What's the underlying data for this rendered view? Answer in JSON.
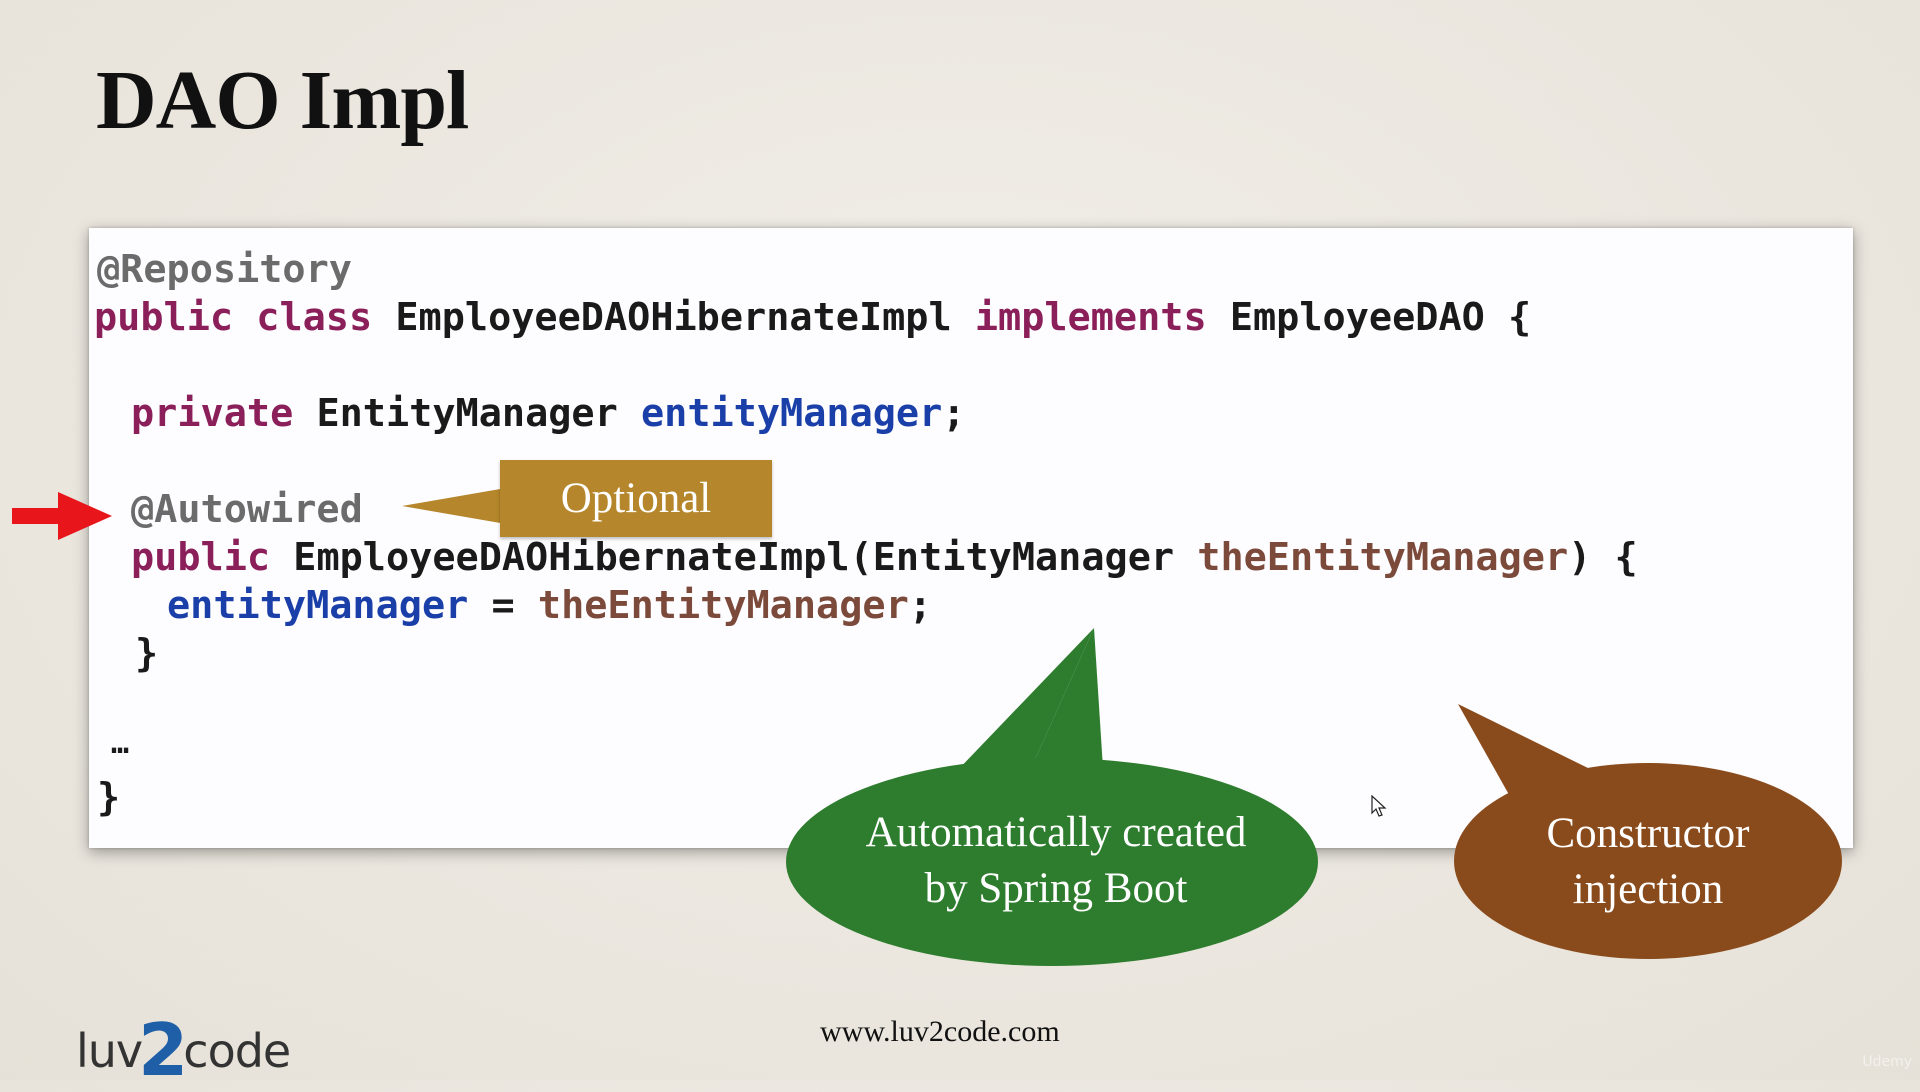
{
  "slide": {
    "title": "DAO Impl"
  },
  "code": {
    "line1": {
      "annotation": "@Repository"
    },
    "line2": {
      "kw1": "public",
      "kw2": "class",
      "name": "EmployeeDAOHibernateImpl",
      "kw3": "implements",
      "iface": "EmployeeDAO",
      "brace": "{"
    },
    "line3": {
      "kw": "private",
      "type": "EntityManager",
      "field": "entityManager",
      "semi": ";"
    },
    "line4": {
      "annotation": "@Autowired"
    },
    "line5": {
      "kw": "public",
      "name": "EmployeeDAOHibernateImpl(EntityManager",
      "param": "theEntityManager",
      "rest": ") {"
    },
    "line6": {
      "field": "entityManager",
      "op": "=",
      "param": "theEntityManager",
      "semi": ";"
    },
    "line7": {
      "brace": "}"
    },
    "line8": {
      "ellipsis": "…"
    },
    "line9": {
      "brace": "}"
    }
  },
  "callouts": {
    "optional": "Optional",
    "auto_line1": "Automatically created",
    "auto_line2": "by Spring Boot",
    "ctor_line1": "Constructor",
    "ctor_line2": "injection"
  },
  "footer": {
    "url": "www.luv2code.com",
    "logo_left": "luv",
    "logo_two": "2",
    "logo_right": "code",
    "watermark": "Udemy"
  },
  "colors": {
    "annotation": "#6b6b6b",
    "keyword": "#8b1f5a",
    "field": "#1b3fa8",
    "param": "#7c4a3a",
    "optional_box": "#b5862b",
    "green_bubble": "#2e7d2e",
    "brown_bubble": "#8a4b1c",
    "arrow": "#e8151b"
  },
  "icons": {
    "pointer_arrow": "red-arrow-icon",
    "mouse_cursor": "mouse-cursor-icon"
  }
}
